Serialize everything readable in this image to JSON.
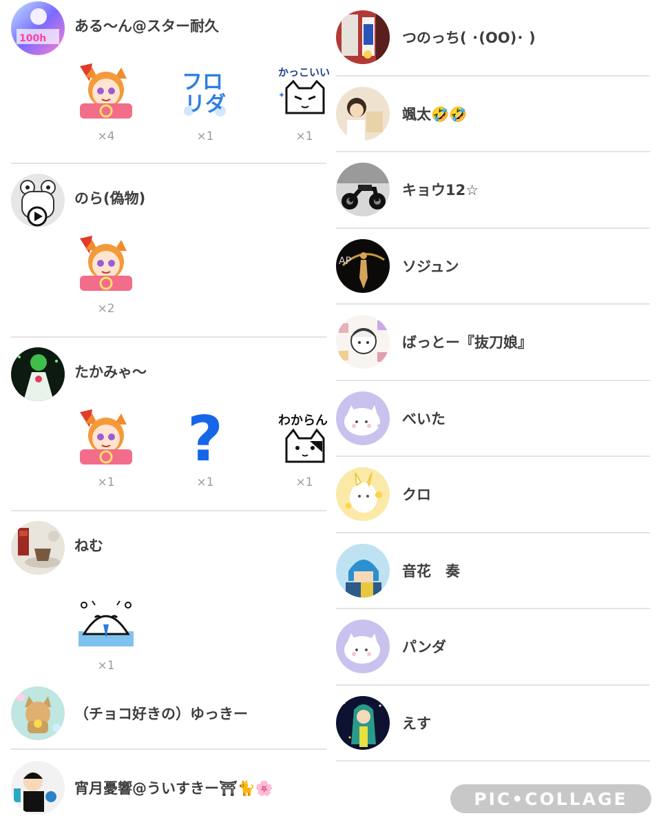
{
  "left_column": [
    {
      "name": "ある〜ん@スター耐久",
      "stickers": [
        {
          "icon": "orange-cat-girl-sticker",
          "count": "×4"
        },
        {
          "icon": "furorida-text-sticker",
          "count": "×1"
        },
        {
          "icon": "kakkoii-cat-sticker",
          "count": "×1"
        }
      ]
    },
    {
      "name": "のら(偽物)",
      "stickers": [
        {
          "icon": "orange-cat-girl-sticker",
          "count": "×2"
        }
      ]
    },
    {
      "name": "たかみゃ〜",
      "stickers": [
        {
          "icon": "orange-cat-girl-sticker",
          "count": "×1"
        },
        {
          "icon": "question-mark-sticker",
          "count": "×1"
        },
        {
          "icon": "wakaran-cat-sticker",
          "count": "×1"
        }
      ]
    },
    {
      "name": "ねむ",
      "stickers": [
        {
          "icon": "crying-face-sticker",
          "count": "×1"
        }
      ]
    },
    {
      "name": "（チョコ好きの）ゆっきー"
    },
    {
      "name": "宵月憂響@ういすきー⛩🐈🌸"
    }
  ],
  "right_column": [
    {
      "name": "つのっち( ･(OO)･ )"
    },
    {
      "name": "颯太🤣🤣"
    },
    {
      "name": "キョウ12☆"
    },
    {
      "name": "ソジュン"
    },
    {
      "name": "ばっとー『抜刀娘』"
    },
    {
      "name": "べいた"
    },
    {
      "name": "クロ"
    },
    {
      "name": "音花　奏"
    },
    {
      "name": "パンダ"
    },
    {
      "name": "えす"
    }
  ],
  "sticker_labels": {
    "furorida": "フロリダ",
    "kakkoii": "かっこいい",
    "wakaran": "わからん",
    "question": "?"
  },
  "watermark": "PIC•COLLAGE",
  "colors": {
    "divider": "#e3e3e3",
    "name_text": "#3d3d3d",
    "count_text": "#9a9a9a",
    "watermark_bg": "#c8c8c8"
  }
}
